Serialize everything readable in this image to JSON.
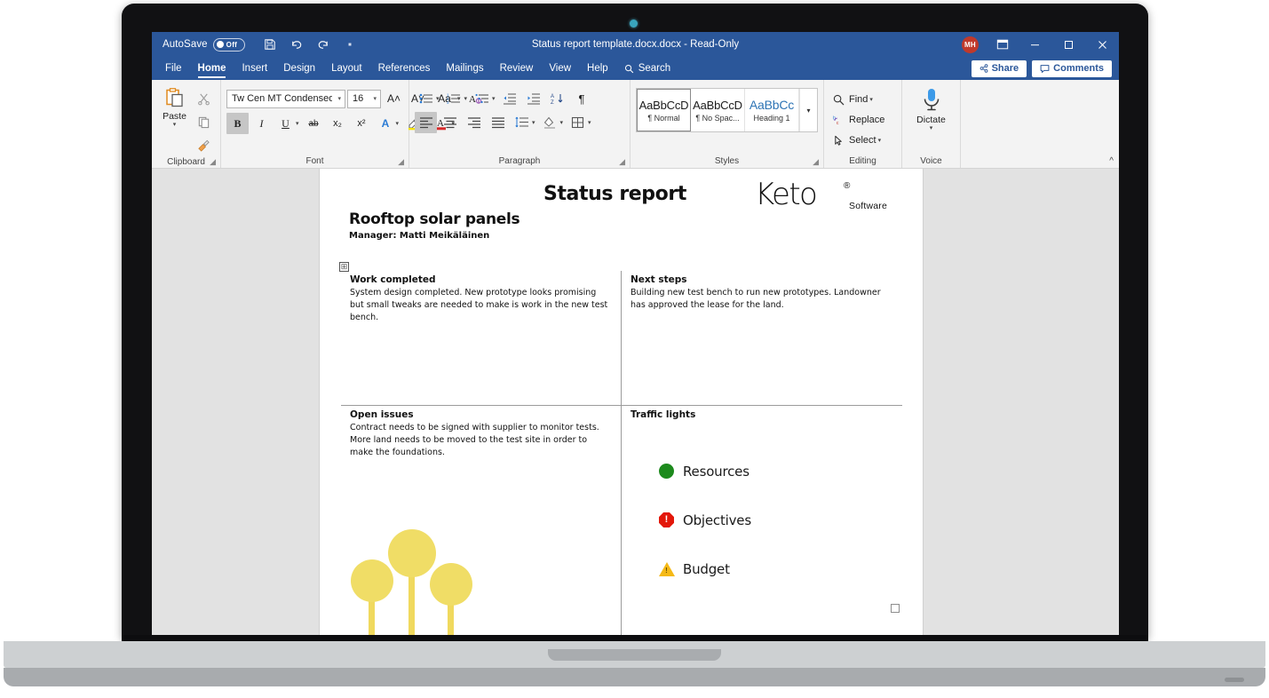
{
  "app": {
    "titlebar": {
      "autosave_label": "AutoSave",
      "autosave_state": "Off",
      "save_icon": "save-icon",
      "undo_icon": "undo-icon",
      "redo_icon": "redo-icon",
      "qat_more_icon": "qat-more-icon",
      "document_title": "Status report template.docx.docx  -  Read-Only",
      "avatar_initials": "MH",
      "ribbon_display_icon": "ribbon-display-options-icon",
      "minimize_label": "—",
      "maximize_label": "□",
      "close_label": "✕"
    },
    "tabs": [
      {
        "label": "File",
        "active": false
      },
      {
        "label": "Home",
        "active": true
      },
      {
        "label": "Insert",
        "active": false
      },
      {
        "label": "Design",
        "active": false
      },
      {
        "label": "Layout",
        "active": false
      },
      {
        "label": "References",
        "active": false
      },
      {
        "label": "Mailings",
        "active": false
      },
      {
        "label": "Review",
        "active": false
      },
      {
        "label": "View",
        "active": false
      },
      {
        "label": "Help",
        "active": false
      }
    ],
    "search": {
      "label": "Search",
      "icon": "search-icon"
    },
    "share_button": {
      "label": "Share",
      "icon": "share-icon"
    },
    "comments_button": {
      "label": "Comments",
      "icon": "comments-icon"
    },
    "ribbon": {
      "collapse_icon": "collapse-ribbon-icon",
      "groups": [
        {
          "name": "Clipboard",
          "paste": {
            "label": "Paste",
            "icon": "paste-icon",
            "caret": "▾"
          },
          "cut": {
            "icon": "cut-icon"
          },
          "copy": {
            "icon": "copy-icon"
          },
          "format_painter": {
            "icon": "format-painter-icon"
          },
          "launcher": "dialog-launcher-icon"
        },
        {
          "name": "Font",
          "font_name": "Tw Cen MT Condensed",
          "font_size": "16",
          "grow_font": "A˄",
          "shrink_font": "A˅",
          "change_case": "Aa",
          "clear_formatting": "clear-formatting-icon",
          "bold": "B",
          "italic": "I",
          "underline": "U",
          "strikethrough": "ab",
          "subscript": "x₂",
          "superscript": "x²",
          "text_effects": "A",
          "highlight": "highlight-icon",
          "font_color": "A",
          "launcher": "dialog-launcher-icon"
        },
        {
          "name": "Paragraph",
          "bullets": "bullets-icon",
          "numbering": "numbering-icon",
          "multilevel": "multilevel-list-icon",
          "decrease_indent": "decrease-indent-icon",
          "increase_indent": "increase-indent-icon",
          "sort": "sort-icon",
          "show_marks": "¶",
          "align_left": "align-left-icon",
          "align_center": "align-center-icon",
          "align_right": "align-right-icon",
          "justify": "justify-icon",
          "line_spacing": "line-spacing-icon",
          "shading": "shading-icon",
          "borders": "borders-icon",
          "launcher": "dialog-launcher-icon"
        },
        {
          "name": "Styles",
          "cards": [
            {
              "sample": "AaBbCcD",
              "label": "¶ Normal",
              "selected": true,
              "heading": false
            },
            {
              "sample": "AaBbCcD",
              "label": "¶ No Spac...",
              "selected": false,
              "heading": false
            },
            {
              "sample": "AaBbCс",
              "label": "Heading 1",
              "selected": false,
              "heading": true
            }
          ],
          "more": "▾",
          "launcher": "dialog-launcher-icon"
        },
        {
          "name": "Editing",
          "find": {
            "label": "Find",
            "icon": "find-icon",
            "caret": "▾"
          },
          "replace": {
            "label": "Replace",
            "icon": "replace-icon"
          },
          "select": {
            "label": "Select",
            "icon": "select-icon",
            "caret": "▾"
          }
        },
        {
          "name": "Voice",
          "dictate": {
            "label": "Dictate",
            "icon": "microphone-icon",
            "caret": "▾"
          }
        }
      ]
    }
  },
  "document": {
    "report_title": "Status report",
    "logo": {
      "word": "Keto",
      "registered": "®",
      "subtitle": "Software"
    },
    "project_title": "Rooftop solar panels",
    "project_manager": "Manager: Matti Meikäläinen",
    "table": {
      "work_completed": {
        "heading": "Work completed",
        "body": "System design completed. New prototype looks promising but small tweaks are needed to make is work in the new test bench."
      },
      "next_steps": {
        "heading": "Next steps",
        "body": "Building new test  bench to run new prototypes. Landowner has approved the lease for the land."
      },
      "open_issues": {
        "heading": "Open issues",
        "body": "Contract needs to be signed with supplier to monitor tests. More land needs to be moved to the test site in order to make the foundations."
      },
      "traffic_lights": {
        "heading": "Traffic lights",
        "items": [
          {
            "label": "Resources",
            "status": "green",
            "icon": "green-circle-icon",
            "color": "#1d8a1d"
          },
          {
            "label": "Objectives",
            "status": "red",
            "icon": "red-octagon-alert-icon",
            "color": "#e3170a"
          },
          {
            "label": "Budget",
            "status": "amber",
            "icon": "amber-triangle-warning-icon",
            "color": "#f5b916"
          }
        ]
      }
    },
    "decorative_trees_color": "#f0dd66",
    "table_move_handle": "table-move-handle-icon",
    "end_of_content_marker": "end-of-content-marker"
  }
}
